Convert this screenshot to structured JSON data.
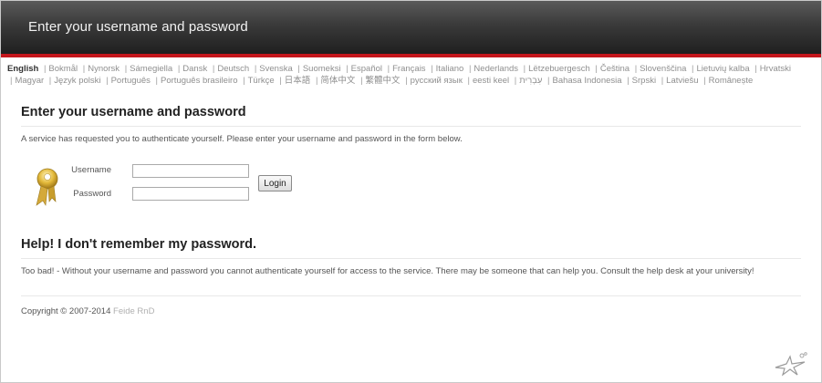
{
  "header": {
    "title": "Enter your username and password"
  },
  "languages": [
    {
      "label": "English",
      "selected": true
    },
    {
      "label": "Bokmål",
      "selected": false
    },
    {
      "label": "Nynorsk",
      "selected": false
    },
    {
      "label": "Sámegiella",
      "selected": false
    },
    {
      "label": "Dansk",
      "selected": false
    },
    {
      "label": "Deutsch",
      "selected": false
    },
    {
      "label": "Svenska",
      "selected": false
    },
    {
      "label": "Suomeksi",
      "selected": false
    },
    {
      "label": "Español",
      "selected": false
    },
    {
      "label": "Français",
      "selected": false
    },
    {
      "label": "Italiano",
      "selected": false
    },
    {
      "label": "Nederlands",
      "selected": false
    },
    {
      "label": "Lëtzebuergesch",
      "selected": false
    },
    {
      "label": "Čeština",
      "selected": false
    },
    {
      "label": "Slovenščina",
      "selected": false
    },
    {
      "label": "Lietuvių kalba",
      "selected": false
    },
    {
      "label": "Hrvatski",
      "selected": false
    },
    {
      "label": "Magyar",
      "selected": false
    },
    {
      "label": "Język polski",
      "selected": false
    },
    {
      "label": "Português",
      "selected": false
    },
    {
      "label": "Português brasileiro",
      "selected": false
    },
    {
      "label": "Türkçe",
      "selected": false
    },
    {
      "label": "日本語",
      "selected": false
    },
    {
      "label": "简体中文",
      "selected": false
    },
    {
      "label": "繁體中文",
      "selected": false
    },
    {
      "label": "русский язык",
      "selected": false
    },
    {
      "label": "eesti keel",
      "selected": false
    },
    {
      "label": "עִבְרִית",
      "selected": false
    },
    {
      "label": "Bahasa Indonesia",
      "selected": false
    },
    {
      "label": "Srpski",
      "selected": false
    },
    {
      "label": "Latviešu",
      "selected": false
    },
    {
      "label": "Românește",
      "selected": false
    }
  ],
  "login": {
    "heading": "Enter your username and password",
    "description": "A service has requested you to authenticate yourself. Please enter your username and password in the form below.",
    "username_label": "Username",
    "username_value": "",
    "password_label": "Password",
    "password_value": "",
    "login_button": "Login"
  },
  "help": {
    "heading": "Help! I don't remember my password.",
    "text": "Too bad! - Without your username and password you cannot authenticate yourself for access to the service. There may be someone that can help you. Consult the help desk at your university!"
  },
  "footer": {
    "copyright_prefix": "Copyright © 2007-2014",
    "copyright_link": "Feide RnD"
  },
  "icons": {
    "key": "key-icon",
    "logo": "feide-logo"
  },
  "colors": {
    "accent": "#c4161c",
    "header_bg": "#2e2e2e"
  }
}
